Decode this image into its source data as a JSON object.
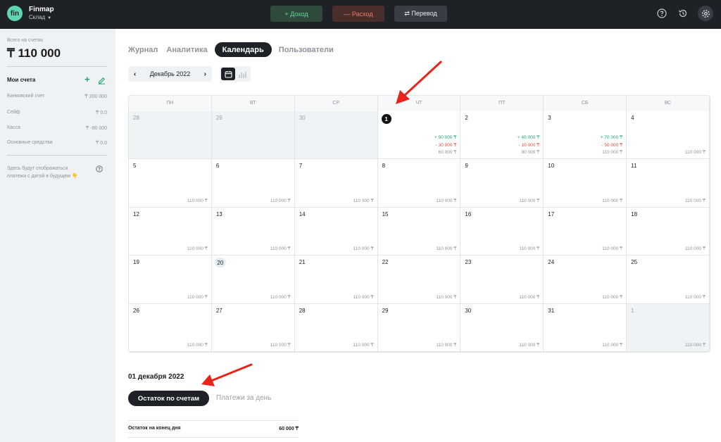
{
  "app": {
    "logo_text": "fin",
    "name": "Finmap",
    "workspace": "Склад"
  },
  "topbar": {
    "income_label": "+ Доход",
    "expense_label": "— Расход",
    "transfer_label": "⇄ Перевод",
    "icons": [
      "help-icon",
      "history-icon",
      "settings-icon"
    ]
  },
  "sidebar": {
    "total_label": "Всего на счетах",
    "total_value": "₸ 110 000",
    "accounts_title": "Мои счета",
    "accounts": [
      {
        "name": "Банковский счет",
        "amount": "₸ 200 000"
      },
      {
        "name": "Сейф",
        "amount": "₸ 0.0"
      },
      {
        "name": "Касса",
        "amount": "₸ -90 000"
      },
      {
        "name": "Основные средства",
        "amount": "₸ 0.0"
      }
    ],
    "future_note": "Здесь будут отображаться платежи с датой в будущем 👇"
  },
  "tabs": [
    {
      "label": "Журнал",
      "active": false
    },
    {
      "label": "Аналитика",
      "active": false
    },
    {
      "label": "Календарь",
      "active": true
    },
    {
      "label": "Пользователи",
      "active": false
    }
  ],
  "calendar": {
    "month_label": "Декабрь 2022",
    "weekdays": [
      "ПН",
      "ВТ",
      "СР",
      "ЧТ",
      "ПТ",
      "СБ",
      "ВС"
    ],
    "cells": [
      {
        "day": "28",
        "muted": true
      },
      {
        "day": "29",
        "muted": true
      },
      {
        "day": "30",
        "muted": true
      },
      {
        "day": "1",
        "today": true,
        "income": "+ 90 000 ₸",
        "expense": "- 30 000 ₸",
        "balance": "60 000 ₸"
      },
      {
        "day": "2",
        "income": "+ 40 000 ₸",
        "expense": "- 10 000 ₸",
        "balance": "90 000 ₸"
      },
      {
        "day": "3",
        "income": "+ 70 000 ₸",
        "expense": "- 50 000 ₸",
        "balance": "110 000 ₸"
      },
      {
        "day": "4",
        "balance": "110 000 ₸"
      },
      {
        "day": "5",
        "balance": "110 000 ₸"
      },
      {
        "day": "6",
        "balance": "110 000 ₸"
      },
      {
        "day": "7",
        "balance": "110 000 ₸"
      },
      {
        "day": "8",
        "balance": "110 000 ₸"
      },
      {
        "day": "9",
        "balance": "110 000 ₸"
      },
      {
        "day": "10",
        "balance": "110 000 ₸"
      },
      {
        "day": "11",
        "balance": "110 000 ₸"
      },
      {
        "day": "12",
        "balance": "110 000 ₸"
      },
      {
        "day": "13",
        "balance": "110 000 ₸"
      },
      {
        "day": "14",
        "balance": "110 000 ₸"
      },
      {
        "day": "15",
        "balance": "110 000 ₸"
      },
      {
        "day": "16",
        "balance": "110 000 ₸"
      },
      {
        "day": "17",
        "balance": "110 000 ₸"
      },
      {
        "day": "18",
        "balance": "110 000 ₸"
      },
      {
        "day": "19",
        "balance": "110 000 ₸"
      },
      {
        "day": "20",
        "current": true,
        "balance": "110 000 ₸"
      },
      {
        "day": "21",
        "balance": "110 000 ₸"
      },
      {
        "day": "22",
        "balance": "110 000 ₸"
      },
      {
        "day": "23",
        "balance": "110 000 ₸"
      },
      {
        "day": "24",
        "balance": "110 000 ₸"
      },
      {
        "day": "25",
        "balance": "110 000 ₸"
      },
      {
        "day": "26",
        "balance": "110 000 ₸"
      },
      {
        "day": "27",
        "balance": "110 000 ₸"
      },
      {
        "day": "28",
        "balance": "110 000 ₸"
      },
      {
        "day": "29",
        "balance": "110 000 ₸"
      },
      {
        "day": "30",
        "balance": "110 000 ₸"
      },
      {
        "day": "31",
        "balance": "110 000 ₸"
      },
      {
        "day": "1",
        "muted": true,
        "balance": "110 000 ₸"
      }
    ]
  },
  "details": {
    "date": "01 декабря 2022",
    "active_tab": "Остаток по счетам",
    "other_tab": "Платежи за день",
    "summary_label": "Остаток на конец дня",
    "summary_value": "60 000 ₸"
  },
  "colors": {
    "accent_green": "#1fa56f",
    "expense_red": "#e54b3c",
    "topbar_bg": "#1e2125",
    "annotation_arrow": "#e8231a"
  }
}
